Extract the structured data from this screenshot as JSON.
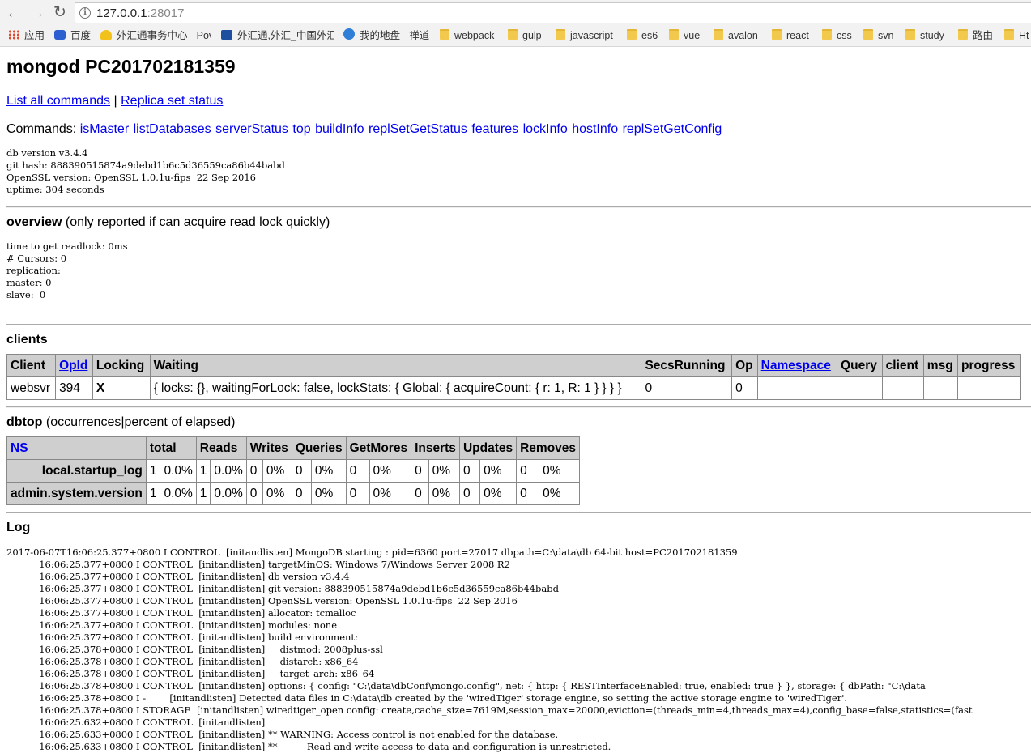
{
  "browser": {
    "url_host": "127.0.0.1",
    "url_port": ":28017",
    "bookmarks": [
      "应用",
      "百度",
      "外汇通事务中心 - Pov",
      "外汇通,外汇_中国外汇",
      "我的地盘 - 禅道",
      "webpack",
      "gulp",
      "javascript",
      "es6",
      "vue",
      "avalon",
      "react",
      "css",
      "svn",
      "study",
      "路由",
      "Ht"
    ]
  },
  "page": {
    "title": "mongod PC201702181359",
    "links": {
      "list_all": "List all commands",
      "sep": "|",
      "replica": "Replica set status"
    },
    "commands_label": "Commands:",
    "commands": [
      "isMaster",
      "listDatabases",
      "serverStatus",
      "top",
      "buildInfo",
      "replSetGetStatus",
      "features",
      "lockInfo",
      "hostInfo",
      "replSetGetConfig"
    ],
    "version_info": "db version v3.4.4\ngit hash: 888390515874a9debd1b6c5d36559ca86b44babd\nOpenSSL version: OpenSSL 1.0.1u-fips  22 Sep 2016\nuptime: 304 seconds"
  },
  "overview": {
    "heading": "overview",
    "note": " (only reported if can acquire read lock quickly)",
    "body": "time to get readlock: 0ms\n# Cursors: 0\nreplication:\nmaster: 0\nslave:  0"
  },
  "clients": {
    "heading": "clients",
    "headers": [
      "Client",
      "OpId",
      "Locking",
      "Waiting",
      "SecsRunning",
      "Op",
      "Namespace",
      "Query",
      "client",
      "msg",
      "progress"
    ],
    "rows": [
      [
        "websvr",
        "394",
        "X",
        "{ locks: {}, waitingForLock: false, lockStats: { Global: { acquireCount: { r: 1, R: 1 } } } }",
        "0",
        "0",
        "",
        "",
        "",
        "",
        ""
      ]
    ]
  },
  "dbtop": {
    "heading": "dbtop",
    "note": " (occurrences|percent of elapsed)",
    "headers": [
      "NS",
      "total",
      "Reads",
      "Writes",
      "Queries",
      "GetMores",
      "Inserts",
      "Updates",
      "Removes"
    ],
    "rows": [
      {
        "ns": "local.startup_log",
        "cells": [
          "1",
          "0.0%",
          "1",
          "0.0%",
          "0",
          "0%",
          "0",
          "0%",
          "0",
          "0%",
          "0",
          "0%",
          "0",
          "0%",
          "0",
          "0%"
        ]
      },
      {
        "ns": "admin.system.version",
        "cells": [
          "1",
          "0.0%",
          "1",
          "0.0%",
          "0",
          "0%",
          "0",
          "0%",
          "0",
          "0%",
          "0",
          "0%",
          "0",
          "0%",
          "0",
          "0%"
        ]
      }
    ]
  },
  "log": {
    "heading": "Log",
    "lines": [
      "2017-06-07T16:06:25.377+0800 I CONTROL  [initandlisten] MongoDB starting : pid=6360 port=27017 dbpath=C:\\data\\db 64-bit host=PC201702181359",
      "           16:06:25.377+0800 I CONTROL  [initandlisten] targetMinOS: Windows 7/Windows Server 2008 R2",
      "           16:06:25.377+0800 I CONTROL  [initandlisten] db version v3.4.4",
      "           16:06:25.377+0800 I CONTROL  [initandlisten] git version: 888390515874a9debd1b6c5d36559ca86b44babd",
      "           16:06:25.377+0800 I CONTROL  [initandlisten] OpenSSL version: OpenSSL 1.0.1u-fips  22 Sep 2016",
      "           16:06:25.377+0800 I CONTROL  [initandlisten] allocator: tcmalloc",
      "           16:06:25.377+0800 I CONTROL  [initandlisten] modules: none",
      "           16:06:25.377+0800 I CONTROL  [initandlisten] build environment:",
      "           16:06:25.378+0800 I CONTROL  [initandlisten]     distmod: 2008plus-ssl",
      "           16:06:25.378+0800 I CONTROL  [initandlisten]     distarch: x86_64",
      "           16:06:25.378+0800 I CONTROL  [initandlisten]     target_arch: x86_64",
      "           16:06:25.378+0800 I CONTROL  [initandlisten] options: { config: \"C:\\data\\dbConf\\mongo.config\", net: { http: { RESTInterfaceEnabled: true, enabled: true } }, storage: { dbPath: \"C:\\data",
      "           16:06:25.378+0800 I -        [initandlisten] Detected data files in C:\\data\\db created by the 'wiredTiger' storage engine, so setting the active storage engine to 'wiredTiger'.",
      "           16:06:25.378+0800 I STORAGE  [initandlisten] wiredtiger_open config: create,cache_size=7619M,session_max=20000,eviction=(threads_min=4,threads_max=4),config_base=false,statistics=(fast",
      "           16:06:25.632+0800 I CONTROL  [initandlisten]",
      "           16:06:25.633+0800 I CONTROL  [initandlisten] ** WARNING: Access control is not enabled for the database.",
      "           16:06:25.633+0800 I CONTROL  [initandlisten] **          Read and write access to data and configuration is unrestricted."
    ]
  }
}
